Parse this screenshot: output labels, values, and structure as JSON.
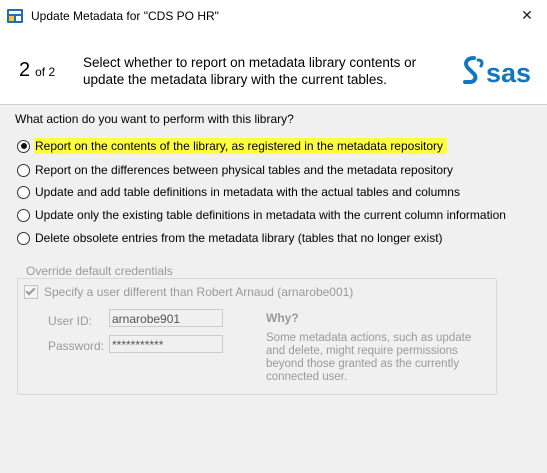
{
  "window": {
    "title": "Update Metadata for \"CDS PO HR\"",
    "close_glyph": "✕"
  },
  "header": {
    "step_current": "2",
    "step_of": "of 2",
    "description": "Select whether to report on metadata library contents or update the metadata library with the current tables.",
    "logo_text": "sas"
  },
  "question": "What action do you want to perform with this library?",
  "options": [
    {
      "label": "Report on the contents of the library, as registered in the metadata repository",
      "checked": true,
      "highlighted": true
    },
    {
      "label": "Report on the differences between physical tables and the metadata repository",
      "checked": false
    },
    {
      "label": "Update and add table definitions in metadata with the actual tables and columns",
      "checked": false
    },
    {
      "label": "Update only the existing table definitions in metadata with the current column information",
      "checked": false
    },
    {
      "label": "Delete obsolete entries from the metadata library (tables that no longer exist)",
      "checked": false
    }
  ],
  "credentials": {
    "legend": "Override default credentials",
    "checkbox_label": "Specify a user different than Robert Arnaud (arnarobe001)",
    "checkbox_checked": true,
    "userid_label": "User ID:",
    "userid_value": "arnarobe901",
    "password_label": "Password:",
    "password_value": "***********",
    "why_title": "Why?",
    "why_text": "Some metadata actions, such as update and delete, might require permissions beyond those granted as the currently connected user."
  },
  "colors": {
    "highlight": "#ffff3a",
    "sas_blue": "#1176c2",
    "disabled_text": "#9a9a9a"
  },
  "icons": {
    "app": "sas-app-icon",
    "close": "close-icon"
  }
}
